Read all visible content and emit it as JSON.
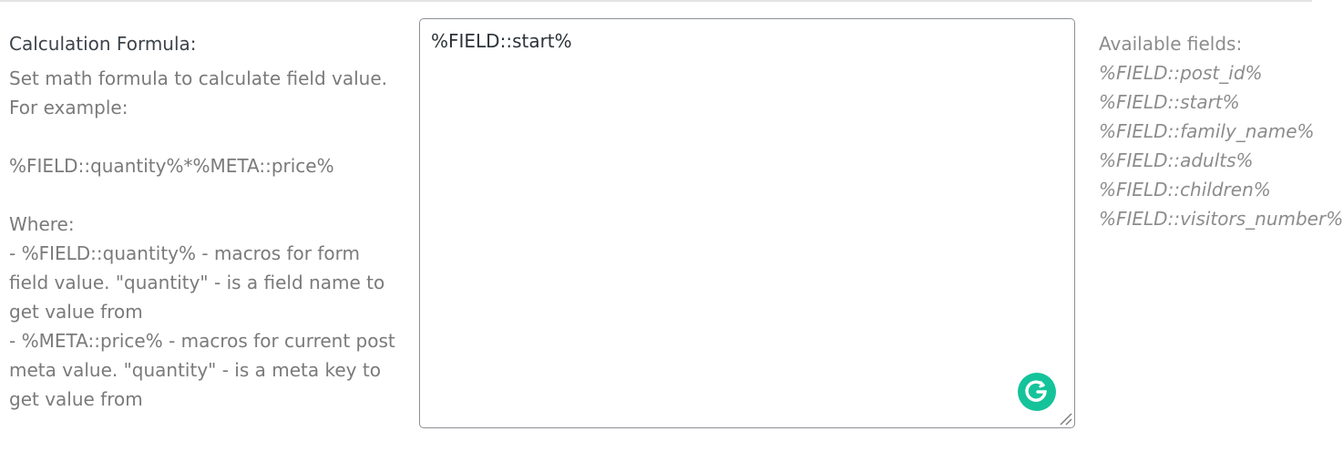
{
  "label": {
    "title": "Calculation Formula:",
    "desc_lines": [
      "Set math formula to calculate field value.",
      "For example:",
      "",
      "%FIELD::quantity%*%META::price%",
      "",
      "Where:",
      "- %FIELD::quantity% - macros for form",
      "field value. \"quantity\" - is a field name to",
      "get value from",
      "- %META::price% - macros for current post",
      "meta value. \"quantity\" - is a meta key to",
      "get value from"
    ]
  },
  "formula": {
    "value": "%FIELD::start%"
  },
  "available_fields": {
    "title": "Available fields:",
    "items": [
      "%FIELD::post_id%",
      "%FIELD::start%",
      "%FIELD::family_name%",
      "%FIELD::adults%",
      "%FIELD::children%",
      "%FIELD::visitors_number%"
    ]
  },
  "colors": {
    "grammarly": "#15c39a",
    "border": "#8c8f94"
  },
  "icons": {
    "grammarly": "grammarly-icon",
    "resize": "resize-handle-icon"
  }
}
